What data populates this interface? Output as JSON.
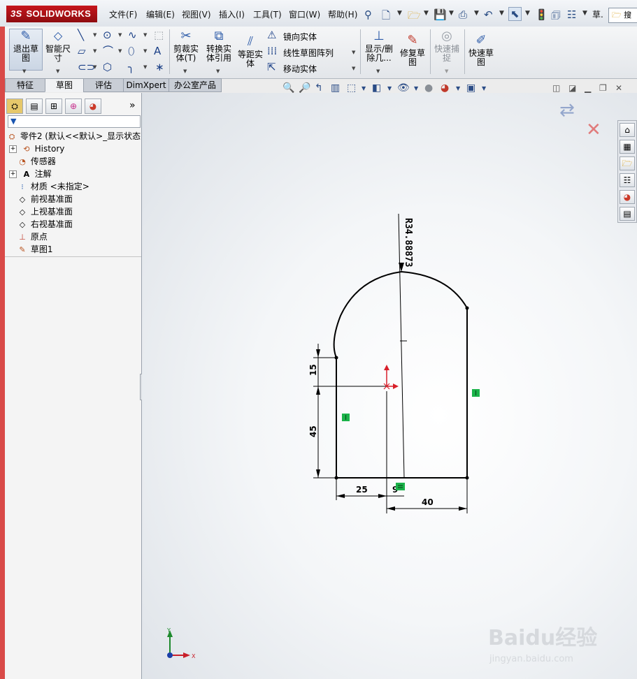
{
  "app": {
    "brand_prefix": "3S",
    "brand_name": "SOLIDWORKS"
  },
  "menu": [
    {
      "key": "file",
      "label": "文件(F)"
    },
    {
      "key": "edit",
      "label": "编辑(E)"
    },
    {
      "key": "view",
      "label": "视图(V)"
    },
    {
      "key": "insert",
      "label": "插入(I)"
    },
    {
      "key": "tools",
      "label": "工具(T)"
    },
    {
      "key": "window",
      "label": "窗口(W)"
    },
    {
      "key": "help",
      "label": "帮助(H)"
    }
  ],
  "search": {
    "label": "搜"
  },
  "quick_access_extra": "草.",
  "commands": {
    "exit_sketch": "退出草图",
    "smart_dimension": "智能尺寸",
    "trim": "剪裁实体(T)",
    "convert": "转换实体引用",
    "offset": "等距实体",
    "mirror": "镜向实体",
    "linear_pattern": "线性草图阵列",
    "move": "移动实体",
    "show_delete": "显示/删除几...",
    "repair": "修复草图",
    "quick_snaps": "快速捕捉",
    "rapid_sketch": "快速草图"
  },
  "tabs": [
    {
      "label": "特征"
    },
    {
      "label": "草图",
      "active": true
    },
    {
      "label": "评估"
    },
    {
      "label": "DimXpert"
    },
    {
      "label": "办公室产品"
    }
  ],
  "feature_tree": {
    "root": "零件2  (默认<<默认>_显示状态",
    "items": [
      {
        "label": "History",
        "icon": "history-icon",
        "expandable": true
      },
      {
        "label": "传感器",
        "icon": "sensor-icon",
        "expandable": false
      },
      {
        "label": "注解",
        "icon": "annotation-icon",
        "expandable": true
      },
      {
        "label": "材质 <未指定>",
        "icon": "material-icon",
        "expandable": false
      },
      {
        "label": "前视基准面",
        "icon": "plane-icon",
        "expandable": false
      },
      {
        "label": "上视基准面",
        "icon": "plane-icon",
        "expandable": false
      },
      {
        "label": "右视基准面",
        "icon": "plane-icon",
        "expandable": false
      },
      {
        "label": "原点",
        "icon": "origin-icon",
        "expandable": false
      },
      {
        "label": "草图1",
        "icon": "sketch-icon",
        "expandable": false
      }
    ]
  },
  "sketch": {
    "dimensions": {
      "radius": "R34.88873",
      "left_upper": "15",
      "left_lower": "45",
      "bottom_left": "25",
      "bottom_mid": "9",
      "bottom_right": "40"
    }
  },
  "triad": {
    "x": "X",
    "y": "Y"
  },
  "watermark": {
    "brand": "Baidu经验",
    "url": "jingyan.baidu.com"
  },
  "colors": {
    "accent_red": "#c6161c",
    "relation_green": "#1bb34a",
    "origin_red": "#d8202a",
    "sketch_line": "#000000"
  }
}
